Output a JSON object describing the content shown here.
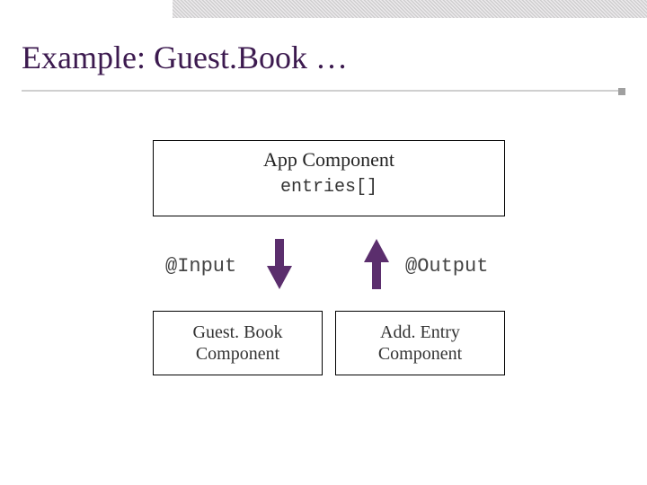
{
  "slide": {
    "title": "Example: Guest.Book …"
  },
  "diagram": {
    "app": {
      "title": "App Component",
      "data_field": "entries[]"
    },
    "labels": {
      "input": "@Input",
      "output": "@Output"
    },
    "arrows": {
      "down_color": "#5b2e6d",
      "up_color": "#5b2e6d"
    },
    "children": {
      "left": {
        "line1": "Guest. Book",
        "line2": "Component"
      },
      "right": {
        "line1": "Add. Entry",
        "line2": "Component"
      }
    }
  }
}
